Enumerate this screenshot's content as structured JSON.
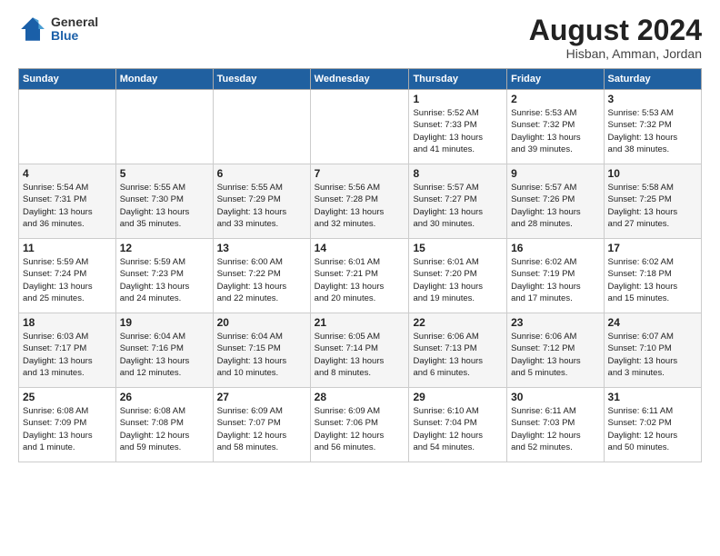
{
  "header": {
    "logo": {
      "general": "General",
      "blue": "Blue"
    },
    "title": "August 2024",
    "subtitle": "Hisban, Amman, Jordan"
  },
  "weekdays": [
    "Sunday",
    "Monday",
    "Tuesday",
    "Wednesday",
    "Thursday",
    "Friday",
    "Saturday"
  ],
  "weeks": [
    [
      {
        "day": "",
        "info": ""
      },
      {
        "day": "",
        "info": ""
      },
      {
        "day": "",
        "info": ""
      },
      {
        "day": "",
        "info": ""
      },
      {
        "day": "1",
        "info": "Sunrise: 5:52 AM\nSunset: 7:33 PM\nDaylight: 13 hours\nand 41 minutes."
      },
      {
        "day": "2",
        "info": "Sunrise: 5:53 AM\nSunset: 7:32 PM\nDaylight: 13 hours\nand 39 minutes."
      },
      {
        "day": "3",
        "info": "Sunrise: 5:53 AM\nSunset: 7:32 PM\nDaylight: 13 hours\nand 38 minutes."
      }
    ],
    [
      {
        "day": "4",
        "info": "Sunrise: 5:54 AM\nSunset: 7:31 PM\nDaylight: 13 hours\nand 36 minutes."
      },
      {
        "day": "5",
        "info": "Sunrise: 5:55 AM\nSunset: 7:30 PM\nDaylight: 13 hours\nand 35 minutes."
      },
      {
        "day": "6",
        "info": "Sunrise: 5:55 AM\nSunset: 7:29 PM\nDaylight: 13 hours\nand 33 minutes."
      },
      {
        "day": "7",
        "info": "Sunrise: 5:56 AM\nSunset: 7:28 PM\nDaylight: 13 hours\nand 32 minutes."
      },
      {
        "day": "8",
        "info": "Sunrise: 5:57 AM\nSunset: 7:27 PM\nDaylight: 13 hours\nand 30 minutes."
      },
      {
        "day": "9",
        "info": "Sunrise: 5:57 AM\nSunset: 7:26 PM\nDaylight: 13 hours\nand 28 minutes."
      },
      {
        "day": "10",
        "info": "Sunrise: 5:58 AM\nSunset: 7:25 PM\nDaylight: 13 hours\nand 27 minutes."
      }
    ],
    [
      {
        "day": "11",
        "info": "Sunrise: 5:59 AM\nSunset: 7:24 PM\nDaylight: 13 hours\nand 25 minutes."
      },
      {
        "day": "12",
        "info": "Sunrise: 5:59 AM\nSunset: 7:23 PM\nDaylight: 13 hours\nand 24 minutes."
      },
      {
        "day": "13",
        "info": "Sunrise: 6:00 AM\nSunset: 7:22 PM\nDaylight: 13 hours\nand 22 minutes."
      },
      {
        "day": "14",
        "info": "Sunrise: 6:01 AM\nSunset: 7:21 PM\nDaylight: 13 hours\nand 20 minutes."
      },
      {
        "day": "15",
        "info": "Sunrise: 6:01 AM\nSunset: 7:20 PM\nDaylight: 13 hours\nand 19 minutes."
      },
      {
        "day": "16",
        "info": "Sunrise: 6:02 AM\nSunset: 7:19 PM\nDaylight: 13 hours\nand 17 minutes."
      },
      {
        "day": "17",
        "info": "Sunrise: 6:02 AM\nSunset: 7:18 PM\nDaylight: 13 hours\nand 15 minutes."
      }
    ],
    [
      {
        "day": "18",
        "info": "Sunrise: 6:03 AM\nSunset: 7:17 PM\nDaylight: 13 hours\nand 13 minutes."
      },
      {
        "day": "19",
        "info": "Sunrise: 6:04 AM\nSunset: 7:16 PM\nDaylight: 13 hours\nand 12 minutes."
      },
      {
        "day": "20",
        "info": "Sunrise: 6:04 AM\nSunset: 7:15 PM\nDaylight: 13 hours\nand 10 minutes."
      },
      {
        "day": "21",
        "info": "Sunrise: 6:05 AM\nSunset: 7:14 PM\nDaylight: 13 hours\nand 8 minutes."
      },
      {
        "day": "22",
        "info": "Sunrise: 6:06 AM\nSunset: 7:13 PM\nDaylight: 13 hours\nand 6 minutes."
      },
      {
        "day": "23",
        "info": "Sunrise: 6:06 AM\nSunset: 7:12 PM\nDaylight: 13 hours\nand 5 minutes."
      },
      {
        "day": "24",
        "info": "Sunrise: 6:07 AM\nSunset: 7:10 PM\nDaylight: 13 hours\nand 3 minutes."
      }
    ],
    [
      {
        "day": "25",
        "info": "Sunrise: 6:08 AM\nSunset: 7:09 PM\nDaylight: 13 hours\nand 1 minute."
      },
      {
        "day": "26",
        "info": "Sunrise: 6:08 AM\nSunset: 7:08 PM\nDaylight: 12 hours\nand 59 minutes."
      },
      {
        "day": "27",
        "info": "Sunrise: 6:09 AM\nSunset: 7:07 PM\nDaylight: 12 hours\nand 58 minutes."
      },
      {
        "day": "28",
        "info": "Sunrise: 6:09 AM\nSunset: 7:06 PM\nDaylight: 12 hours\nand 56 minutes."
      },
      {
        "day": "29",
        "info": "Sunrise: 6:10 AM\nSunset: 7:04 PM\nDaylight: 12 hours\nand 54 minutes."
      },
      {
        "day": "30",
        "info": "Sunrise: 6:11 AM\nSunset: 7:03 PM\nDaylight: 12 hours\nand 52 minutes."
      },
      {
        "day": "31",
        "info": "Sunrise: 6:11 AM\nSunset: 7:02 PM\nDaylight: 12 hours\nand 50 minutes."
      }
    ]
  ]
}
